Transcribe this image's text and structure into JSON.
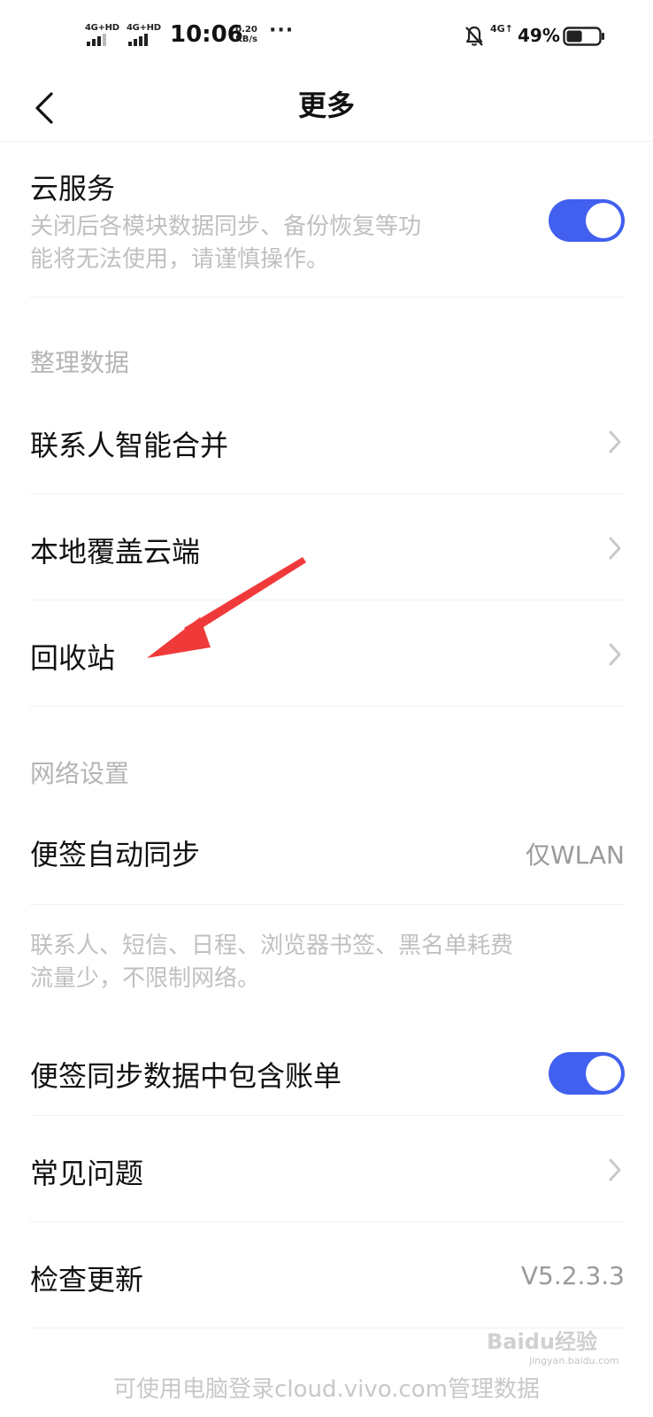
{
  "status_bar": {
    "sim1_label": "4G+HD",
    "sim2_label": "4G+HD",
    "time": "10:06",
    "speed_value": "0.20",
    "speed_unit": "KB/s",
    "more": "···",
    "network": "4G↑",
    "battery": "49%",
    "battery_level": 0.49
  },
  "header": {
    "title": "更多",
    "back_icon": "chevron-left-icon"
  },
  "cloud_service": {
    "label": "云服务",
    "desc_line1": "关闭后各模块数据同步、备份恢复等功",
    "desc_line2": "能将无法使用，请谨慎操作。",
    "enabled": true
  },
  "organize_section": {
    "header": "整理数据",
    "items": [
      {
        "label": "联系人智能合并"
      },
      {
        "label": "本地覆盖云端"
      },
      {
        "label": "回收站"
      }
    ]
  },
  "network_section": {
    "header": "网络设置",
    "notes_sync_label": "便签自动同步",
    "notes_sync_value": "仅WLAN",
    "desc_line1": "联系人、短信、日程、浏览器书签、黑名单耗费",
    "desc_line2": "流量少，不限制网络。",
    "bill_sync_label": "便签同步数据中包含账单",
    "bill_sync_enabled": true
  },
  "faq": {
    "label": "常见问题"
  },
  "check_update": {
    "label": "检查更新",
    "version": "V5.2.3.3"
  },
  "footer_note": "可使用电脑登录cloud.vivo.com管理数据",
  "watermark": {
    "main": "Baidu经验",
    "sub": "jingyan.baidu.com"
  },
  "colors": {
    "accent": "#4160f0",
    "annotation_arrow": "#f03a3a"
  }
}
